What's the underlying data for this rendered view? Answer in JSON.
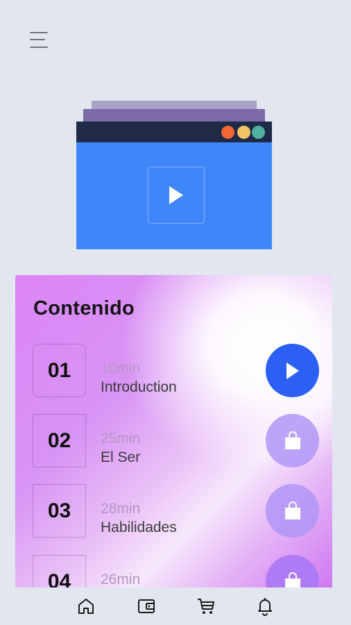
{
  "header": {
    "menu_icon": "hamburger-menu-icon"
  },
  "illustration": {
    "colors": {
      "window": "#3f87f9",
      "bar": "#1f2a47",
      "dots": [
        "#f46733",
        "#f4c567",
        "#4fb09d"
      ]
    },
    "play_icon": "play-icon"
  },
  "content": {
    "title": "Contenido",
    "lessons": [
      {
        "number": "01",
        "duration": "10min",
        "name": "Introduction",
        "action": "play",
        "action_icon": "play-icon"
      },
      {
        "number": "02",
        "duration": "25min",
        "name": "El Ser",
        "action": "locked",
        "action_icon": "shopping-bag-icon"
      },
      {
        "number": "03",
        "duration": "28min",
        "name": "Habilidades",
        "action": "locked",
        "action_icon": "shopping-bag-icon"
      },
      {
        "number": "04",
        "duration": "26min",
        "name": "",
        "action": "locked",
        "action_icon": "shopping-bag-icon"
      }
    ]
  },
  "bottom_nav": {
    "items": [
      {
        "icon": "home-icon"
      },
      {
        "icon": "wallet-icon"
      },
      {
        "icon": "cart-icon"
      },
      {
        "icon": "bell-icon"
      }
    ]
  },
  "colors": {
    "background": "#e2e7ef",
    "accent": "#2c5ff4",
    "locked": "#b096f6"
  }
}
